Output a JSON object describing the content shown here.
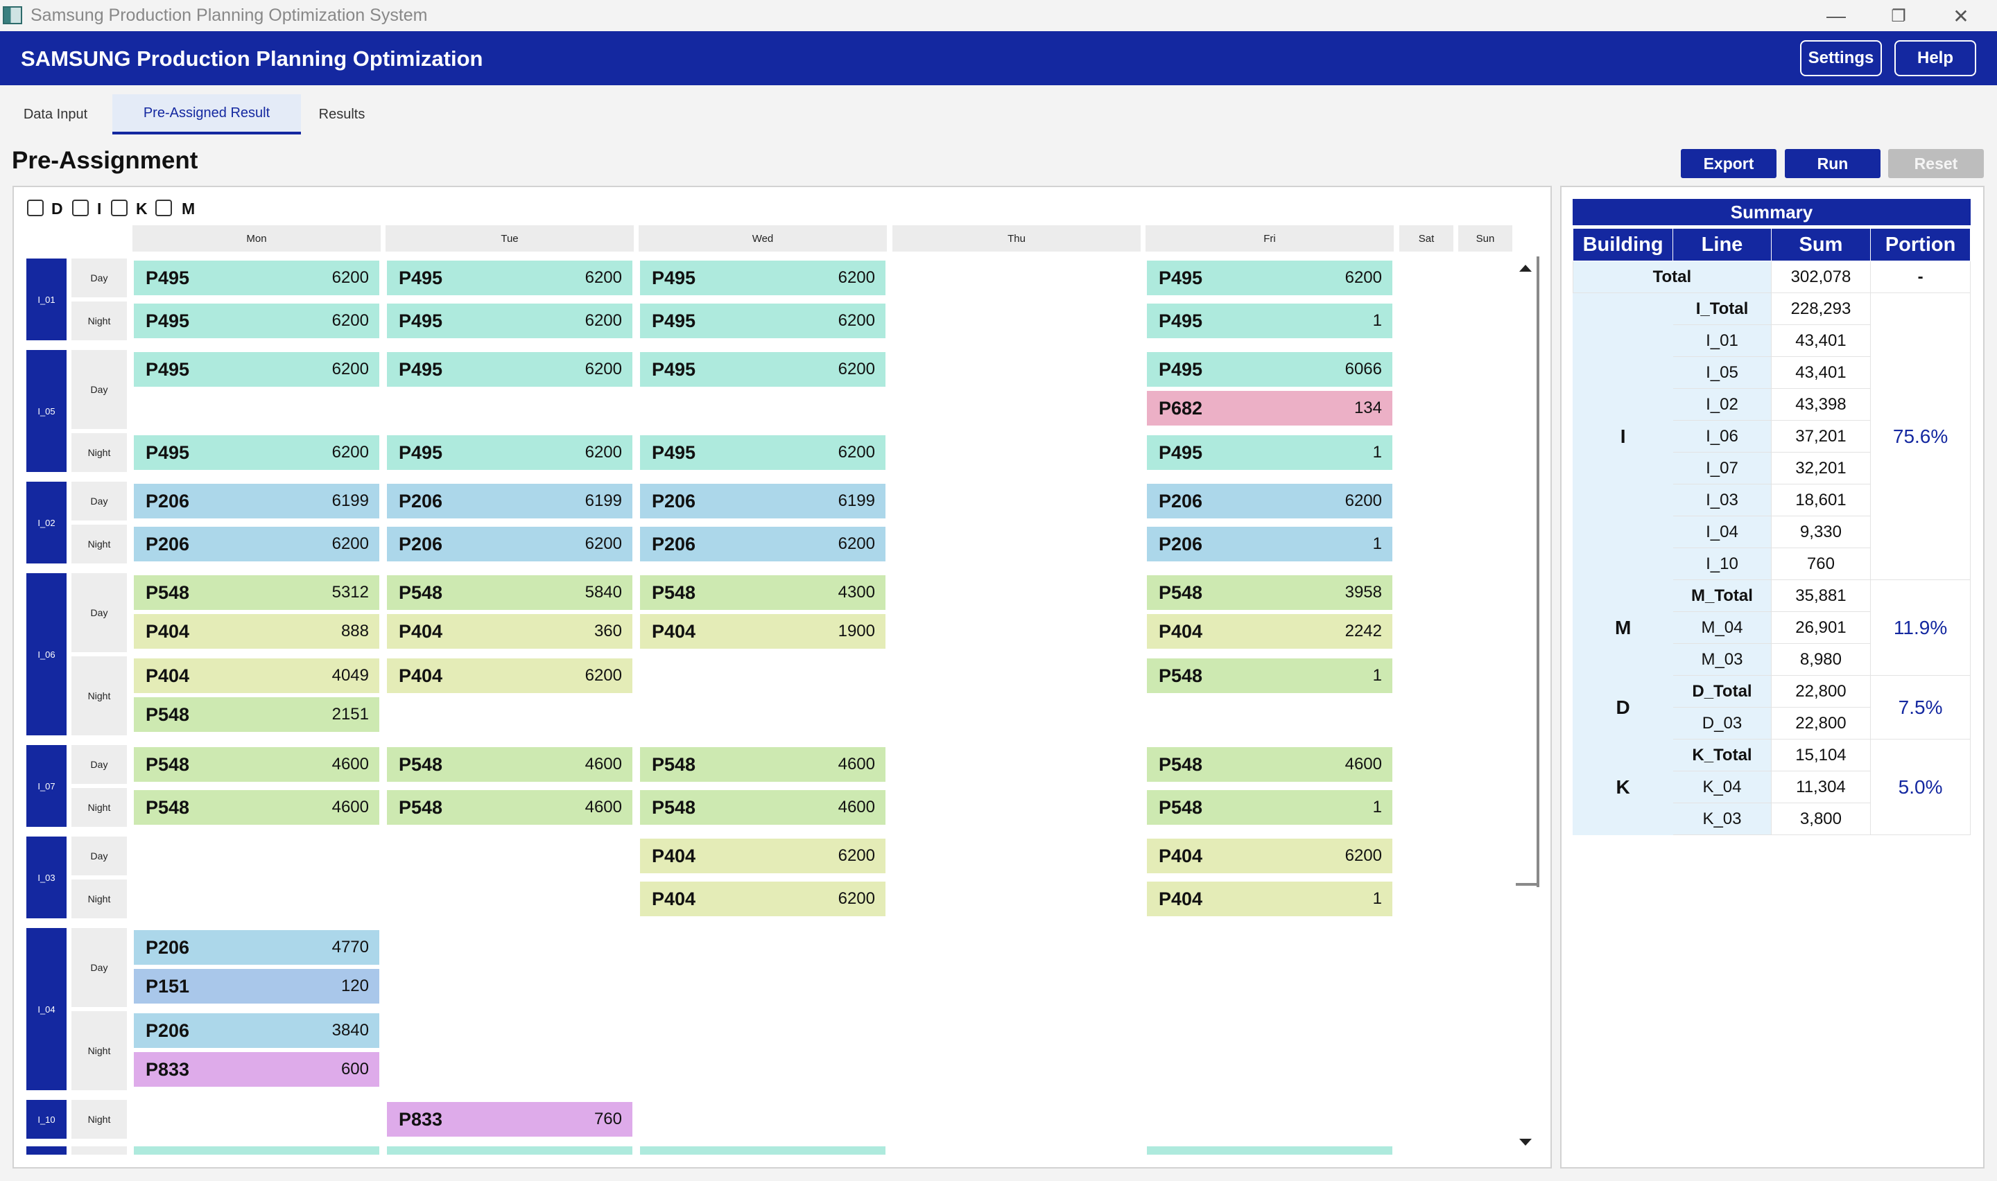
{
  "window": {
    "title": "Samsung Production Planning Optimization System"
  },
  "header": {
    "title": "SAMSUNG Production Planning Optimization",
    "settings_label": "Settings",
    "help_label": "Help"
  },
  "tabs": [
    {
      "label": "Data Input"
    },
    {
      "label": "Pre-Assigned Result",
      "active": true
    },
    {
      "label": "Results"
    }
  ],
  "page": {
    "title": "Pre-Assignment"
  },
  "actions": {
    "export_label": "Export",
    "run_label": "Run",
    "reset_label": "Reset"
  },
  "filters": [
    {
      "label": "D",
      "checked": false
    },
    {
      "label": "I",
      "checked": false
    },
    {
      "label": "K",
      "checked": false
    },
    {
      "label": "M",
      "checked": false
    }
  ],
  "days": [
    "Mon",
    "Tue",
    "Wed",
    "Thu",
    "Fri",
    "Sat",
    "Sun"
  ],
  "product_colors": {
    "P495": "#aeeadd",
    "P682": "#ecb0c6",
    "P206": "#acd7ea",
    "P548": "#cde9b1",
    "P404": "#e4ecb7",
    "P151": "#a9c7ea",
    "P833": "#deabea"
  },
  "schedule": [
    {
      "line": "I_01",
      "shifts": [
        {
          "shift": "Day",
          "rows": 1,
          "assignments": [
            {
              "day": "Mon",
              "row": 0,
              "product": "P495",
              "qty": "6200"
            },
            {
              "day": "Tue",
              "row": 0,
              "product": "P495",
              "qty": "6200"
            },
            {
              "day": "Wed",
              "row": 0,
              "product": "P495",
              "qty": "6200"
            },
            {
              "day": "Fri",
              "row": 0,
              "product": "P495",
              "qty": "6200"
            }
          ]
        },
        {
          "shift": "Night",
          "rows": 1,
          "assignments": [
            {
              "day": "Mon",
              "row": 0,
              "product": "P495",
              "qty": "6200"
            },
            {
              "day": "Tue",
              "row": 0,
              "product": "P495",
              "qty": "6200"
            },
            {
              "day": "Wed",
              "row": 0,
              "product": "P495",
              "qty": "6200"
            },
            {
              "day": "Fri",
              "row": 0,
              "product": "P495",
              "qty": "1"
            }
          ]
        }
      ]
    },
    {
      "line": "I_05",
      "shifts": [
        {
          "shift": "Day",
          "rows": 2,
          "assignments": [
            {
              "day": "Mon",
              "row": 0,
              "product": "P495",
              "qty": "6200"
            },
            {
              "day": "Tue",
              "row": 0,
              "product": "P495",
              "qty": "6200"
            },
            {
              "day": "Wed",
              "row": 0,
              "product": "P495",
              "qty": "6200"
            },
            {
              "day": "Fri",
              "row": 0,
              "product": "P495",
              "qty": "6066"
            },
            {
              "day": "Fri",
              "row": 1,
              "product": "P682",
              "qty": "134"
            }
          ]
        },
        {
          "shift": "Night",
          "rows": 1,
          "assignments": [
            {
              "day": "Mon",
              "row": 0,
              "product": "P495",
              "qty": "6200"
            },
            {
              "day": "Tue",
              "row": 0,
              "product": "P495",
              "qty": "6200"
            },
            {
              "day": "Wed",
              "row": 0,
              "product": "P495",
              "qty": "6200"
            },
            {
              "day": "Fri",
              "row": 0,
              "product": "P495",
              "qty": "1"
            }
          ]
        }
      ]
    },
    {
      "line": "I_02",
      "shifts": [
        {
          "shift": "Day",
          "rows": 1,
          "assignments": [
            {
              "day": "Mon",
              "row": 0,
              "product": "P206",
              "qty": "6199"
            },
            {
              "day": "Tue",
              "row": 0,
              "product": "P206",
              "qty": "6199"
            },
            {
              "day": "Wed",
              "row": 0,
              "product": "P206",
              "qty": "6199"
            },
            {
              "day": "Fri",
              "row": 0,
              "product": "P206",
              "qty": "6200"
            }
          ]
        },
        {
          "shift": "Night",
          "rows": 1,
          "assignments": [
            {
              "day": "Mon",
              "row": 0,
              "product": "P206",
              "qty": "6200"
            },
            {
              "day": "Tue",
              "row": 0,
              "product": "P206",
              "qty": "6200"
            },
            {
              "day": "Wed",
              "row": 0,
              "product": "P206",
              "qty": "6200"
            },
            {
              "day": "Fri",
              "row": 0,
              "product": "P206",
              "qty": "1"
            }
          ]
        }
      ]
    },
    {
      "line": "I_06",
      "shifts": [
        {
          "shift": "Day",
          "rows": 2,
          "assignments": [
            {
              "day": "Mon",
              "row": 0,
              "product": "P548",
              "qty": "5312"
            },
            {
              "day": "Tue",
              "row": 0,
              "product": "P548",
              "qty": "5840"
            },
            {
              "day": "Wed",
              "row": 0,
              "product": "P548",
              "qty": "4300"
            },
            {
              "day": "Fri",
              "row": 0,
              "product": "P548",
              "qty": "3958"
            },
            {
              "day": "Mon",
              "row": 1,
              "product": "P404",
              "qty": "888"
            },
            {
              "day": "Tue",
              "row": 1,
              "product": "P404",
              "qty": "360"
            },
            {
              "day": "Wed",
              "row": 1,
              "product": "P404",
              "qty": "1900"
            },
            {
              "day": "Fri",
              "row": 1,
              "product": "P404",
              "qty": "2242"
            }
          ]
        },
        {
          "shift": "Night",
          "rows": 2,
          "assignments": [
            {
              "day": "Mon",
              "row": 0,
              "product": "P404",
              "qty": "4049"
            },
            {
              "day": "Tue",
              "row": 0,
              "product": "P404",
              "qty": "6200"
            },
            {
              "day": "Fri",
              "row": 0,
              "product": "P548",
              "qty": "1"
            },
            {
              "day": "Mon",
              "row": 1,
              "product": "P548",
              "qty": "2151"
            }
          ]
        }
      ]
    },
    {
      "line": "I_07",
      "shifts": [
        {
          "shift": "Day",
          "rows": 1,
          "assignments": [
            {
              "day": "Mon",
              "row": 0,
              "product": "P548",
              "qty": "4600"
            },
            {
              "day": "Tue",
              "row": 0,
              "product": "P548",
              "qty": "4600"
            },
            {
              "day": "Wed",
              "row": 0,
              "product": "P548",
              "qty": "4600"
            },
            {
              "day": "Fri",
              "row": 0,
              "product": "P548",
              "qty": "4600"
            }
          ]
        },
        {
          "shift": "Night",
          "rows": 1,
          "assignments": [
            {
              "day": "Mon",
              "row": 0,
              "product": "P548",
              "qty": "4600"
            },
            {
              "day": "Tue",
              "row": 0,
              "product": "P548",
              "qty": "4600"
            },
            {
              "day": "Wed",
              "row": 0,
              "product": "P548",
              "qty": "4600"
            },
            {
              "day": "Fri",
              "row": 0,
              "product": "P548",
              "qty": "1"
            }
          ]
        }
      ]
    },
    {
      "line": "I_03",
      "shifts": [
        {
          "shift": "Day",
          "rows": 1,
          "assignments": [
            {
              "day": "Wed",
              "row": 0,
              "product": "P404",
              "qty": "6200"
            },
            {
              "day": "Fri",
              "row": 0,
              "product": "P404",
              "qty": "6200"
            }
          ]
        },
        {
          "shift": "Night",
          "rows": 1,
          "assignments": [
            {
              "day": "Wed",
              "row": 0,
              "product": "P404",
              "qty": "6200"
            },
            {
              "day": "Fri",
              "row": 0,
              "product": "P404",
              "qty": "1"
            }
          ]
        }
      ]
    },
    {
      "line": "I_04",
      "shifts": [
        {
          "shift": "Day",
          "rows": 2,
          "assignments": [
            {
              "day": "Mon",
              "row": 0,
              "product": "P206",
              "qty": "4770"
            },
            {
              "day": "Mon",
              "row": 1,
              "product": "P151",
              "qty": "120"
            }
          ]
        },
        {
          "shift": "Night",
          "rows": 2,
          "assignments": [
            {
              "day": "Mon",
              "row": 0,
              "product": "P206",
              "qty": "3840"
            },
            {
              "day": "Mon",
              "row": 1,
              "product": "P833",
              "qty": "600"
            }
          ]
        }
      ]
    },
    {
      "line": "I_10",
      "shifts": [
        {
          "shift": "Night",
          "rows": 1,
          "assignments": [
            {
              "day": "Tue",
              "row": 0,
              "product": "P833",
              "qty": "760"
            }
          ]
        }
      ]
    }
  ],
  "summary": {
    "title": "Summary",
    "headers": [
      "Building",
      "Line",
      "Sum",
      "Portion"
    ],
    "total": {
      "label": "Total",
      "sum": "302,078",
      "portion": "-"
    },
    "buildings": [
      {
        "building": "I",
        "total_label": "I_Total",
        "total_sum": "228,293",
        "portion": "75.6%",
        "lines": [
          [
            "I_01",
            "43,401"
          ],
          [
            "I_05",
            "43,401"
          ],
          [
            "I_02",
            "43,398"
          ],
          [
            "I_06",
            "37,201"
          ],
          [
            "I_07",
            "32,201"
          ],
          [
            "I_03",
            "18,601"
          ],
          [
            "I_04",
            "9,330"
          ],
          [
            "I_10",
            "760"
          ]
        ]
      },
      {
        "building": "M",
        "total_label": "M_Total",
        "total_sum": "35,881",
        "portion": "11.9%",
        "lines": [
          [
            "M_04",
            "26,901"
          ],
          [
            "M_03",
            "8,980"
          ]
        ]
      },
      {
        "building": "D",
        "total_label": "D_Total",
        "total_sum": "22,800",
        "portion": "7.5%",
        "lines": [
          [
            "D_03",
            "22,800"
          ]
        ]
      },
      {
        "building": "K",
        "total_label": "K_Total",
        "total_sum": "15,104",
        "portion": "5.0%",
        "lines": [
          [
            "K_04",
            "11,304"
          ],
          [
            "K_03",
            "3,800"
          ]
        ]
      }
    ]
  }
}
